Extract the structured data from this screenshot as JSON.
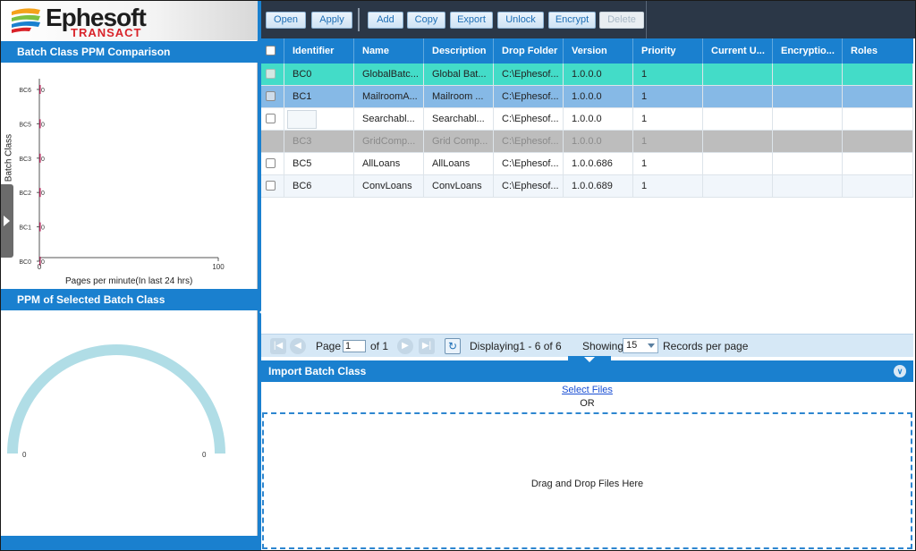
{
  "app": {
    "brand": "Ephesoft",
    "product": "TRANSACT"
  },
  "left": {
    "ppm_title": "Batch Class PPM Comparison",
    "selected_title": "PPM of Selected Batch Class"
  },
  "chart_data": [
    {
      "type": "bar",
      "orientation": "horizontal",
      "title": "",
      "categories": [
        "BC6",
        "BC5",
        "BC3",
        "BC2",
        "BC1",
        "BC0"
      ],
      "values": [
        0,
        0,
        0,
        0,
        0,
        0
      ],
      "value_labels": [
        "0",
        "0",
        "0",
        "0",
        "0",
        "0"
      ],
      "xlabel": "Pages per minute(In last 24 hrs)",
      "ylabel": "Batch Class",
      "xlim": [
        0,
        100
      ],
      "xticks": [
        "0",
        "100"
      ],
      "grid": false
    },
    {
      "type": "gauge",
      "value": 0,
      "min_label": "0",
      "max_label": "0",
      "color": "#b0dde6"
    }
  ],
  "toolbar": {
    "buttons": [
      {
        "label": "Open",
        "enabled": true
      },
      {
        "label": "Apply",
        "enabled": true
      },
      {
        "label": "Add",
        "enabled": true
      },
      {
        "label": "Copy",
        "enabled": true
      },
      {
        "label": "Export",
        "enabled": true
      },
      {
        "label": "Unlock",
        "enabled": true
      },
      {
        "label": "Encrypt",
        "enabled": true
      },
      {
        "label": "Delete",
        "enabled": false
      }
    ]
  },
  "grid": {
    "columns": [
      "Identifier",
      "Name",
      "Description",
      "Drop Folder",
      "Version",
      "Priority",
      "Current U...",
      "Encryptio...",
      "Roles"
    ],
    "rows": [
      {
        "id": "BC0",
        "name": "GlobalBatc...",
        "desc": "Global Bat...",
        "folder": "C:\\Ephesof...",
        "version": "1.0.0.0",
        "priority": "1",
        "current": "",
        "encryption": "",
        "roles": ""
      },
      {
        "id": "BC1",
        "name": "MailroomA...",
        "desc": "Mailroom ...",
        "folder": "C:\\Ephesof...",
        "version": "1.0.0.0",
        "priority": "1",
        "current": "",
        "encryption": "",
        "roles": ""
      },
      {
        "id": "",
        "name": "Searchabl...",
        "desc": "Searchabl...",
        "folder": "C:\\Ephesof...",
        "version": "1.0.0.0",
        "priority": "1",
        "current": "",
        "encryption": "",
        "roles": ""
      },
      {
        "id": "BC3",
        "name": "GridComp...",
        "desc": "Grid Comp...",
        "folder": "C:\\Ephesof...",
        "version": "1.0.0.0",
        "priority": "1",
        "current": "",
        "encryption": "",
        "roles": ""
      },
      {
        "id": "BC5",
        "name": "AllLoans",
        "desc": "AllLoans",
        "folder": "C:\\Ephesof...",
        "version": "1.0.0.686",
        "priority": "1",
        "current": "",
        "encryption": "",
        "roles": ""
      },
      {
        "id": "BC6",
        "name": "ConvLoans",
        "desc": "ConvLoans",
        "folder": "C:\\Ephesof...",
        "version": "1.0.0.689",
        "priority": "1",
        "current": "",
        "encryption": "",
        "roles": ""
      }
    ]
  },
  "pager": {
    "page_label": "Page",
    "page_value": "1",
    "of_label": "of 1",
    "displaying": "Displaying1 - 6 of 6",
    "showing_label": "Showing",
    "showing_value": "15",
    "records_label": "Records per page"
  },
  "import": {
    "title": "Import Batch Class",
    "select_files": "Select Files",
    "or": "OR",
    "drop_text": "Drag and Drop Files Here"
  },
  "colors": {
    "header_blue": "#1a80cf",
    "toolbar_dark": "#2b3747",
    "row_selected_teal": "#43dcc8",
    "row_selected_blue": "#86b9e6",
    "row_disabled": "#bdbdbd",
    "brand_red": "#d9232a"
  }
}
